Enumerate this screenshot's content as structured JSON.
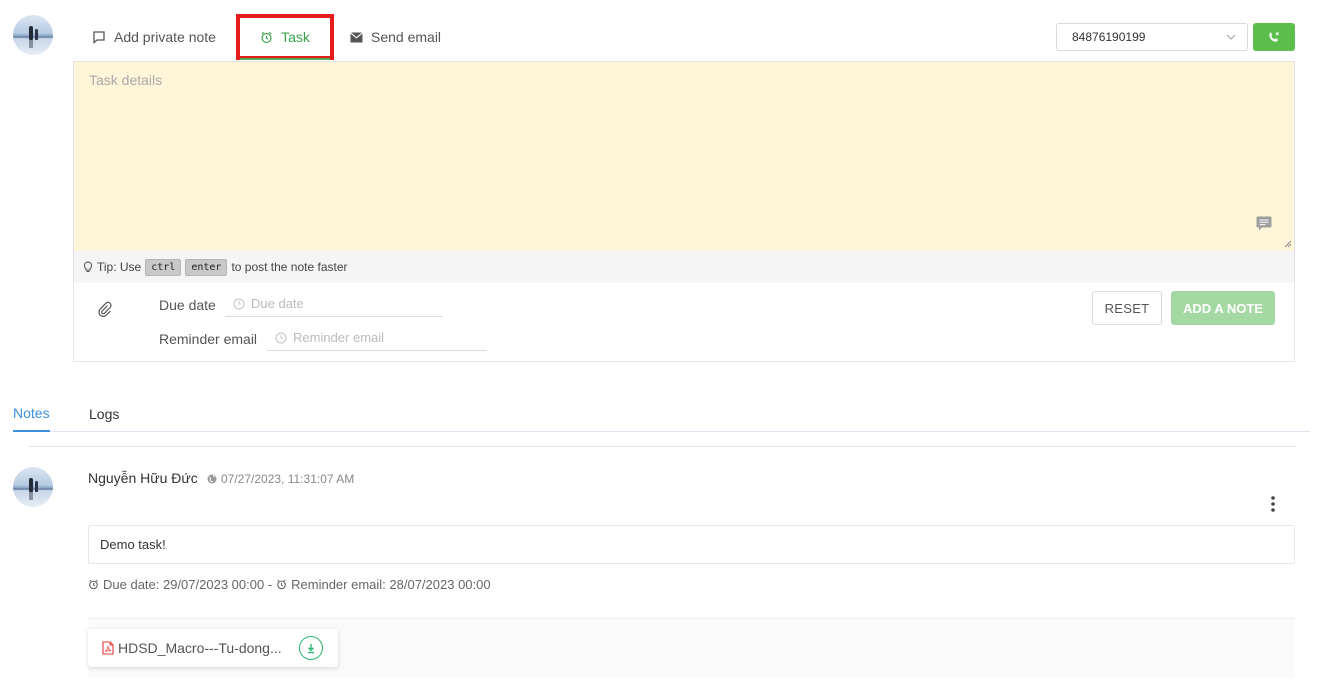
{
  "composer": {
    "tabs": [
      {
        "label": "Add private note",
        "icon": "chat-bubble-icon"
      },
      {
        "label": "Task",
        "icon": "alarm-clock-icon",
        "active": true
      },
      {
        "label": "Send email",
        "icon": "envelope-icon"
      }
    ],
    "phone": {
      "selected": "84876190199"
    },
    "task_placeholder": "Task details",
    "tip": {
      "prefix": "Tip: Use",
      "key1": "ctrl",
      "key2": "enter",
      "suffix": "to post the note faster"
    },
    "due_date": {
      "label": "Due date",
      "placeholder": "Due date"
    },
    "reminder": {
      "label": "Reminder email",
      "placeholder": "Reminder email"
    },
    "reset_label": "RESET",
    "add_label": "ADD A NOTE"
  },
  "feed": {
    "tabs": [
      {
        "label": "Notes",
        "active": true
      },
      {
        "label": "Logs"
      }
    ],
    "entries": [
      {
        "author": "Nguyễn Hữu Đức",
        "time": "07/27/2023, 11:31:07 AM",
        "body": "Demo task!",
        "due_text": "Due date: 29/07/2023 00:00 -",
        "reminder_text": "Reminder email: 28/07/2023 00:00",
        "attachment": "HDSD_Macro---Tu-dong..."
      }
    ]
  },
  "colors": {
    "accent_green": "#5cbf4b",
    "task_bg": "#fff5d9",
    "tab_blue": "#3d8fe0",
    "highlight_red": "#e41b1b"
  }
}
